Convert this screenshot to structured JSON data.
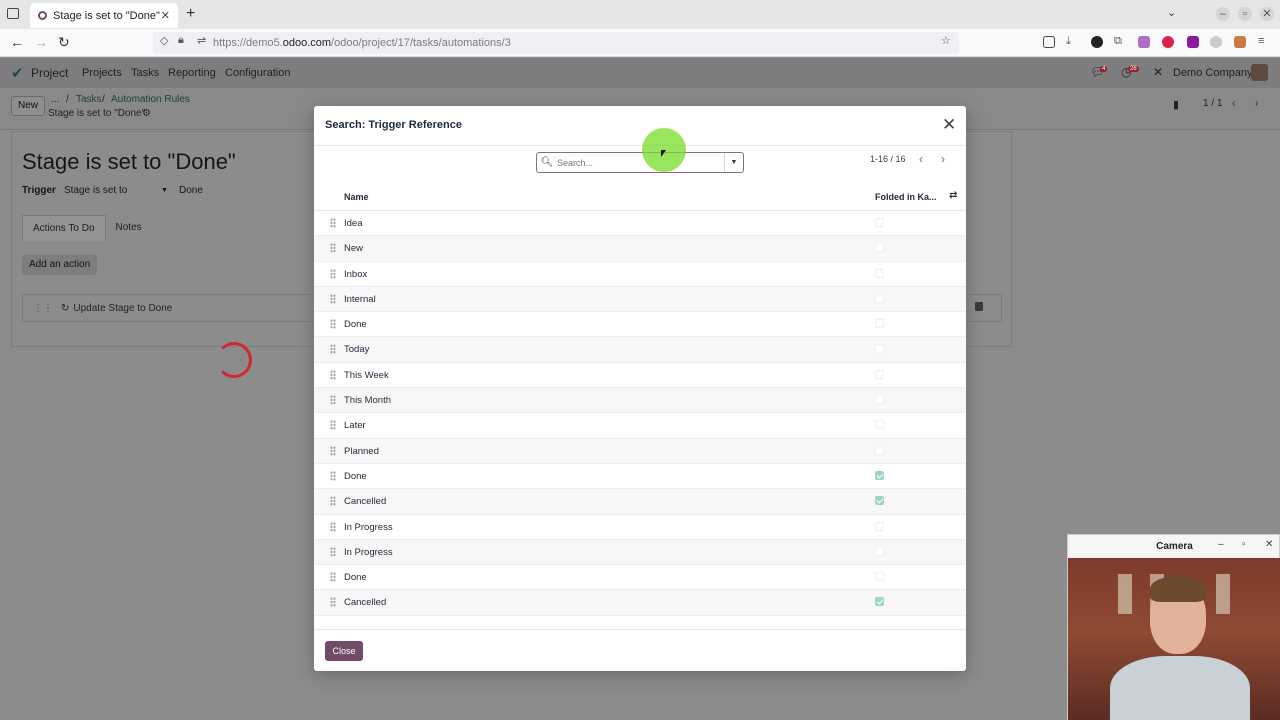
{
  "browser": {
    "tab_title": "Stage is set to \"Done\"",
    "url_prefix": "https://demo5.",
    "url_domain": "odoo.com",
    "url_path": "/odoo/project/17/tasks/automations/3"
  },
  "odoo_nav": {
    "app_name": "Project",
    "menu": [
      "Projects",
      "Tasks",
      "Reporting",
      "Configuration"
    ],
    "company": "Demo Company",
    "chat_badge": "4",
    "activity_badge": "28"
  },
  "control_panel": {
    "new_label": "New",
    "crumb_more": "...",
    "crumb_tasks": "Tasks",
    "crumb_rules": "Automation Rules",
    "current": "Stage is set to \"Done\"",
    "pager": "1 / 1"
  },
  "form": {
    "title": "Stage is set to \"Done\"",
    "trigger_label": "Trigger",
    "trigger_value": "Stage is set to",
    "trigger_target": "Done",
    "tabs": [
      "Actions To Do",
      "Notes"
    ],
    "add_action": "Add an action",
    "action_item": "Update Stage to Done"
  },
  "modal": {
    "title": "Search: Trigger Reference",
    "search_placeholder": "Search...",
    "pager": "1-16 / 16",
    "col_name": "Name",
    "col_folded": "Folded in Ka...",
    "close_label": "Close",
    "rows": [
      {
        "name": "Idea",
        "folded": false
      },
      {
        "name": "New",
        "folded": false
      },
      {
        "name": "Inbox",
        "folded": false
      },
      {
        "name": "Internal",
        "folded": false
      },
      {
        "name": "Done",
        "folded": false
      },
      {
        "name": "Today",
        "folded": false
      },
      {
        "name": "This Week",
        "folded": false
      },
      {
        "name": "This Month",
        "folded": false
      },
      {
        "name": "Later",
        "folded": false
      },
      {
        "name": "Planned",
        "folded": false
      },
      {
        "name": "Done",
        "folded": true
      },
      {
        "name": "Cancelled",
        "folded": true
      },
      {
        "name": "In Progress",
        "folded": false
      },
      {
        "name": "In Progress",
        "folded": false
      },
      {
        "name": "Done",
        "folded": false
      },
      {
        "name": "Cancelled",
        "folded": true
      }
    ]
  },
  "camera": {
    "title": "Camera"
  },
  "colors": {
    "brand": "#714b67",
    "check": "#9fd4cc",
    "cursor_highlight": "#78dc28",
    "spinner": "#d2262f"
  }
}
